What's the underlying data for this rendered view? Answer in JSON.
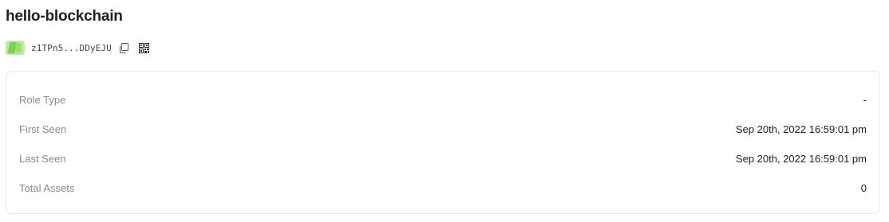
{
  "page": {
    "title": "hello-blockchain"
  },
  "account": {
    "address_short": "z1TPn5...DDyEJU",
    "copy_icon": "copy-icon",
    "qr_icon": "qr-code-icon",
    "avatar_colors": [
      "#bfe9a6",
      "#7fce5a",
      "#9edc7d"
    ]
  },
  "details": {
    "rows": [
      {
        "label": "Role Type",
        "value": "-"
      },
      {
        "label": "First Seen",
        "value": "Sep 20th, 2022 16:59:01 pm"
      },
      {
        "label": "Last Seen",
        "value": "Sep 20th, 2022 16:59:01 pm"
      },
      {
        "label": "Total Assets",
        "value": "0"
      }
    ]
  }
}
